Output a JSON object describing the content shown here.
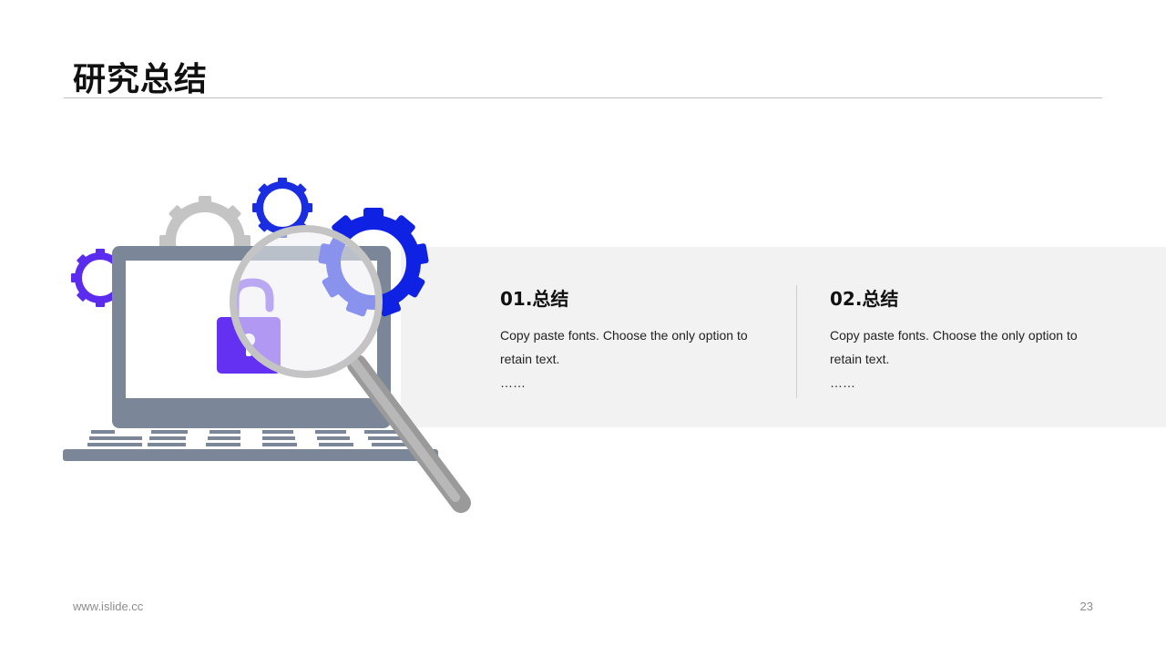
{
  "slide": {
    "title": "研究总结",
    "page_number": "23",
    "website": "www.islide.cc"
  },
  "columns": [
    {
      "heading": "01.总结",
      "body": "Copy paste fonts. Choose the only option to retain text.",
      "ellipsis": "……"
    },
    {
      "heading": "02.总结",
      "body": "Copy paste fonts. Choose the only option to retain text.",
      "ellipsis": "……"
    }
  ],
  "colors": {
    "accent_blue": "#1a2de0",
    "accent_purple": "#5b2cf0",
    "gear_gray": "#c4c4c4",
    "laptop_gray": "#7b8798",
    "band_bg": "#f2f2f2"
  },
  "icons": [
    "laptop-icon",
    "padlock-icon",
    "magnifier-icon",
    "gear-icon"
  ]
}
